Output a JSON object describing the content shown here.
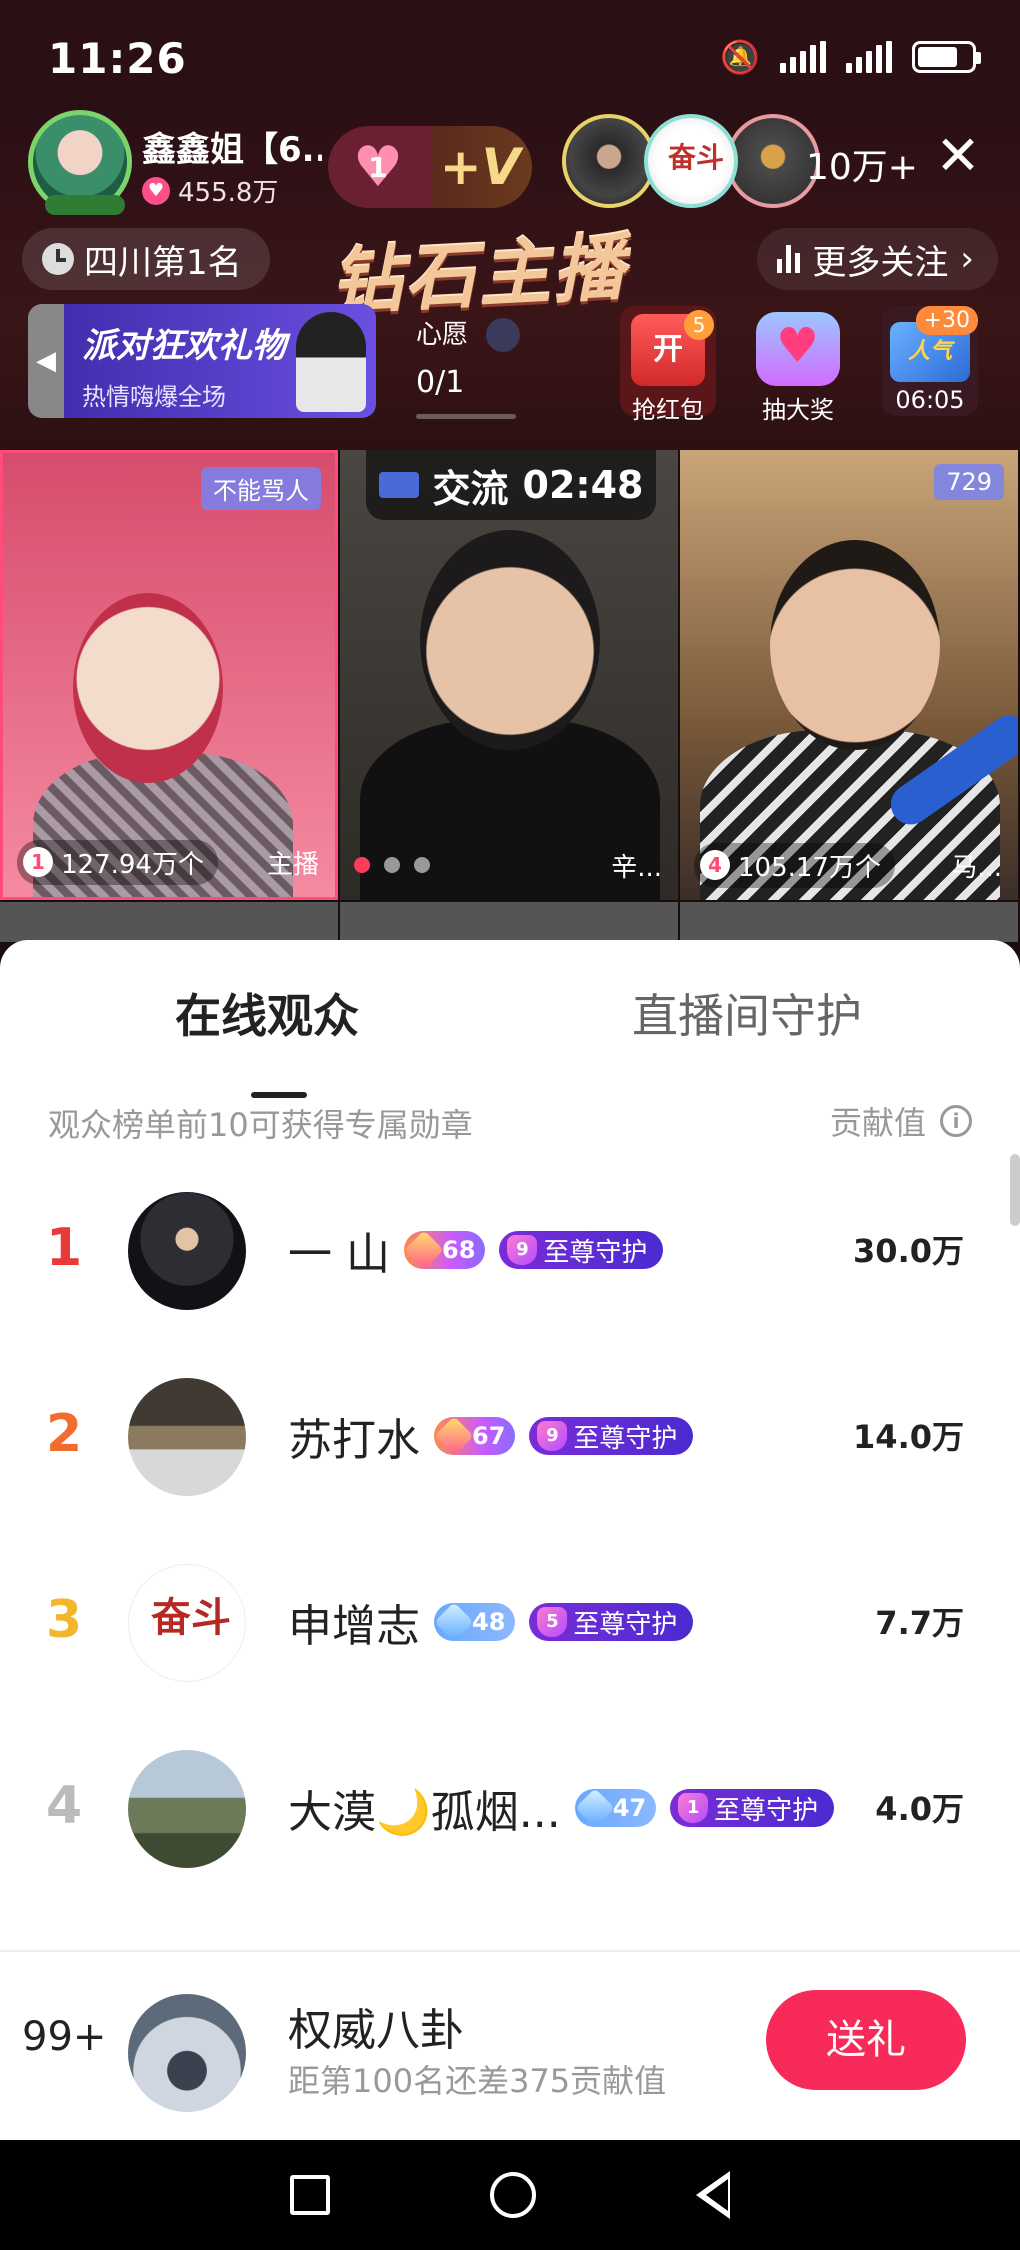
{
  "status": {
    "time": "11:26",
    "battery_level": 0.75
  },
  "header": {
    "host_name": "鑫鑫姐【6...",
    "host_likes": "455.8万",
    "follow_count": "1",
    "follow_suffix": "+V",
    "viewer_count": "10万+",
    "rank_text": "四川第1名",
    "banner_text": "钻石主播",
    "more_follow": "更多关注",
    "party_title": "派对狂欢礼物",
    "party_sub": "热情嗨爆全场",
    "wish_label": "心愿",
    "wish_value": "0/1",
    "actions": [
      {
        "label": "抢红包",
        "badge": "5",
        "icon_text": "开"
      },
      {
        "label": "抽大奖"
      },
      {
        "label": "06:05",
        "badge": "+30",
        "icon_text": "人气"
      }
    ]
  },
  "grid": {
    "timer_label": "交流",
    "timer_value": "02:48",
    "cells": [
      {
        "tag": "不能骂人",
        "gift_rank": "1",
        "gift_value": "127.94万个",
        "role": "主播"
      },
      {
        "name": "辛..."
      },
      {
        "tag": "729",
        "gift_rank": "4",
        "gift_value": "105.17万个",
        "name": "马..."
      }
    ]
  },
  "sheet": {
    "tabs": [
      "在线观众",
      "直播间守护"
    ],
    "hint": "观众榜单前10可获得专属勋章",
    "contrib_header": "贡献值",
    "rows": [
      {
        "rank": "1",
        "name": "一 山",
        "level": "68",
        "guard_level": "9",
        "guard_label": "至尊守护",
        "score": "30.0万"
      },
      {
        "rank": "2",
        "name": "苏打水",
        "level": "67",
        "guard_level": "9",
        "guard_label": "至尊守护",
        "score": "14.0万"
      },
      {
        "rank": "3",
        "name": "申增志",
        "level": "48",
        "guard_level": "5",
        "guard_label": "至尊守护",
        "score": "7.7万"
      },
      {
        "rank": "4",
        "name": "大漠🌙孤烟...",
        "level": "47",
        "guard_level": "1",
        "guard_label": "至尊守护",
        "score": "4.0万"
      }
    ],
    "me": {
      "rank": "99+",
      "name": "权威八卦",
      "sub": "距第100名还差375贡献值",
      "gift_button": "送礼"
    }
  }
}
